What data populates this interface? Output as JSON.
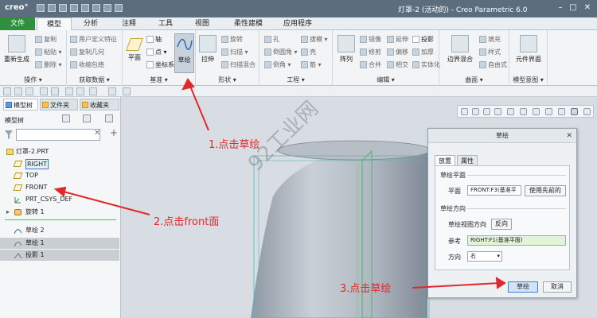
{
  "titlebar": {
    "logo": "creo°",
    "title": "灯罩-2 (活动的) - Creo Parametric 6.0",
    "min": "–",
    "max": "□",
    "close": "✕"
  },
  "menu": {
    "tabs": [
      "文件",
      "模型",
      "分析",
      "注释",
      "工具",
      "视图",
      "柔性建模",
      "应用程序"
    ],
    "active_index": 1
  },
  "ribbon": {
    "groups": {
      "operations": {
        "label": "操作 ▾",
        "items": [
          "复制",
          "粘贴 ▾",
          "删除 ▾"
        ],
        "regenerate": "重新生成"
      },
      "getdata": {
        "label": "获取数据 ▾",
        "items": [
          "用户定义特征",
          "复制几何",
          "收缩包络"
        ]
      },
      "datum": {
        "label": "基准 ▾",
        "plane": "平面",
        "axis": "轴",
        "point": "点 ▾",
        "csys": "坐标系",
        "sketch": "草绘"
      },
      "shapes": {
        "label": "形状 ▾",
        "extrude": "拉伸",
        "items": [
          "旋转",
          "扫描 ▾",
          "扫描混合"
        ]
      },
      "engineering": {
        "label": "工程 ▾",
        "items": [
          "孔",
          "倒圆角 ▾",
          "倒角 ▾",
          "拔模 ▾",
          "壳",
          "筋 ▾"
        ]
      },
      "editing": {
        "label": "编辑 ▾",
        "pattern": "阵列",
        "items": [
          "镜像",
          "修剪",
          "合并",
          "延伸",
          "偏移",
          "相交",
          "投影",
          "加厚",
          "实体化"
        ]
      },
      "surfaces": {
        "label": "曲面 ▾",
        "boundary": "边界混合",
        "items": [
          "填充",
          "样式",
          "自由式"
        ]
      },
      "intent": {
        "label": "模型意图 ▾",
        "item": "元件界面"
      }
    }
  },
  "panel": {
    "tabs": [
      "模型树",
      "文件夹",
      "收藏夹"
    ],
    "tree_header": "模型树",
    "tree": [
      {
        "label": "灯罩-2.PRT",
        "icon": "part-icon",
        "kind": "root"
      },
      {
        "label": "RIGHT",
        "icon": "datum-plane-icon",
        "kind": "plane"
      },
      {
        "label": "TOP",
        "icon": "datum-plane-icon",
        "kind": "plane"
      },
      {
        "label": "FRONT",
        "icon": "datum-plane-icon",
        "kind": "plane"
      },
      {
        "label": "PRT_CSYS_DEF",
        "icon": "csys-icon",
        "kind": "csys"
      },
      {
        "label": "旋转 1",
        "icon": "revolve-icon",
        "kind": "feature"
      },
      {
        "label": "草绘 2",
        "icon": "sketch-icon",
        "kind": "feature"
      },
      {
        "label": "草绘 1",
        "icon": "sketch-icon",
        "kind": "grey"
      },
      {
        "label": "投影 1",
        "icon": "projection-icon",
        "kind": "grey"
      }
    ]
  },
  "dialog": {
    "title": "草绘",
    "close": "✕",
    "tabs": [
      "放置",
      "属性"
    ],
    "plane_section": "草绘平面",
    "plane_label": "平面",
    "plane_value": "FRONT:F3(基准平",
    "use_previous": "使用先前的",
    "orient_section": "草绘方向",
    "view_dir_label": "草绘视图方向",
    "flip": "反向",
    "ref_label": "参考",
    "ref_value": "RIGHT:F1(基准平面)",
    "dir_label": "方向",
    "dir_value": "右",
    "ok": "草绘",
    "cancel": "取消"
  },
  "annotations": {
    "step1": "1.点击草绘",
    "step2": "2.点击front面",
    "step3": "3.点击草绘",
    "color": "#e0292b"
  },
  "watermark": "92工业网"
}
